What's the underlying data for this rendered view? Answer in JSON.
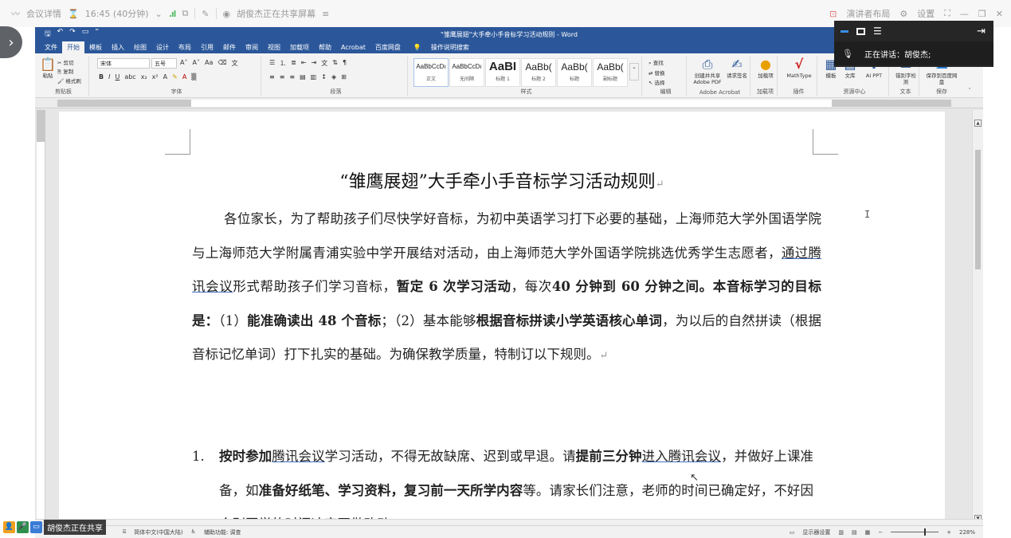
{
  "meeting_bar": {
    "details": "会议详情",
    "time": "16:45 (40分钟)",
    "sharing_label": "胡俊杰正在共享屏幕",
    "layout_label": "演讲者布局",
    "settings_label": "设置"
  },
  "word": {
    "document_title": "\"雏鹰展翅\"大手牵小手音标学习活动规则 - Word",
    "tabs": [
      "文件",
      "开始",
      "模板",
      "插入",
      "绘图",
      "设计",
      "布局",
      "引用",
      "邮件",
      "审阅",
      "视图",
      "加载项",
      "帮助",
      "Acrobat",
      "百度网盘"
    ],
    "active_tab": "开始",
    "tell_me": "操作说明搜索",
    "ribbon": {
      "clipboard": {
        "paste": "粘贴",
        "cut": "剪切",
        "copy": "复制",
        "format_painter": "格式刷",
        "label": "剪贴板"
      },
      "font": {
        "name": "宋体",
        "size": "五号",
        "label": "字体"
      },
      "paragraph": {
        "label": "段落"
      },
      "styles": {
        "label": "样式",
        "items": [
          {
            "sample": "AaBbCcDı",
            "name": "正文"
          },
          {
            "sample": "AaBbCcDı",
            "name": "无间隔"
          },
          {
            "sample": "AaBI",
            "name": "标题 1"
          },
          {
            "sample": "AaBb(",
            "name": "标题 2"
          },
          {
            "sample": "AaBb(",
            "name": "标题"
          },
          {
            "sample": "AaBb(",
            "name": "副标题"
          }
        ]
      },
      "editing": {
        "find": "查找",
        "replace": "替换",
        "select": "选择",
        "label": "编辑"
      },
      "adobe": {
        "create_share": "创建并共享 Adobe PDF",
        "request_sign": "请求签名",
        "label": "Adobe Acrobat"
      },
      "addins": {
        "item": "加载项",
        "label": "加载项"
      },
      "mathtype": {
        "item": "MathType",
        "label": "插件"
      },
      "resources": {
        "template": "模板",
        "library": "文库",
        "ai_ppt": "AI PPT",
        "label": "资源中心"
      },
      "text": {
        "typo_check": "错别字检测",
        "label": "文本"
      },
      "save": {
        "save_to": "保存到百度网盘",
        "label": "保存"
      }
    },
    "status": {
      "language": "简体中文(中国大陆)",
      "accessibility": "辅助功能: 调查",
      "display_settings": "显示器设置",
      "zoom": "228%"
    }
  },
  "document": {
    "heading": "“雏鹰展翅”大手牵小手音标学习活动规则",
    "para1": {
      "s1": "各位家长，为了帮助孩子们尽快学好音标，为初中英语学习打下必要的基础，上海师范大学外国语学院与上海师范大学附属青浦实验中学开展结对活动，由上海师范大学外国语学院挑选优秀学生志愿者，",
      "s2_u": "通过腾讯会议",
      "s3": "形式帮助孩子们学习音标，",
      "s4_b": "暂定 6 次学习活动",
      "s5": "，每次",
      "s6_b": "40 分钟到 60 分钟之间。本音标学习的目标是：",
      "s7": "（1）",
      "s8_b": "能准确读出 48 个音标",
      "s9": "；（2）基本能够",
      "s10_b": "根据音标拼读小学英语核心单词",
      "s11": "，为以后的自然拼读（根据音标记忆单词）打下扎实的基础。为确保教学质量，特制订以下规则。"
    },
    "item1": {
      "num": "1.",
      "a_b": "按时参加",
      "b_u": "腾讯会议",
      "c": "学习活动，不得无故缺席、迟到或早退。请",
      "d_b": "提前三分钟",
      "e_u": "进入腾讯会议",
      "f": "，并做好上课准备，如",
      "g_b": "准备好纸笔、学习资料，复习前一天所学内容",
      "h": "等。请家长们注意，老师的时间已确定好，不好因个别同学的时间冲突再做改动。"
    }
  },
  "speaker_panel": {
    "speaking_label": "正在讲话：胡俊杰;"
  },
  "share_badge": {
    "label": "胡俊杰正在共享"
  }
}
